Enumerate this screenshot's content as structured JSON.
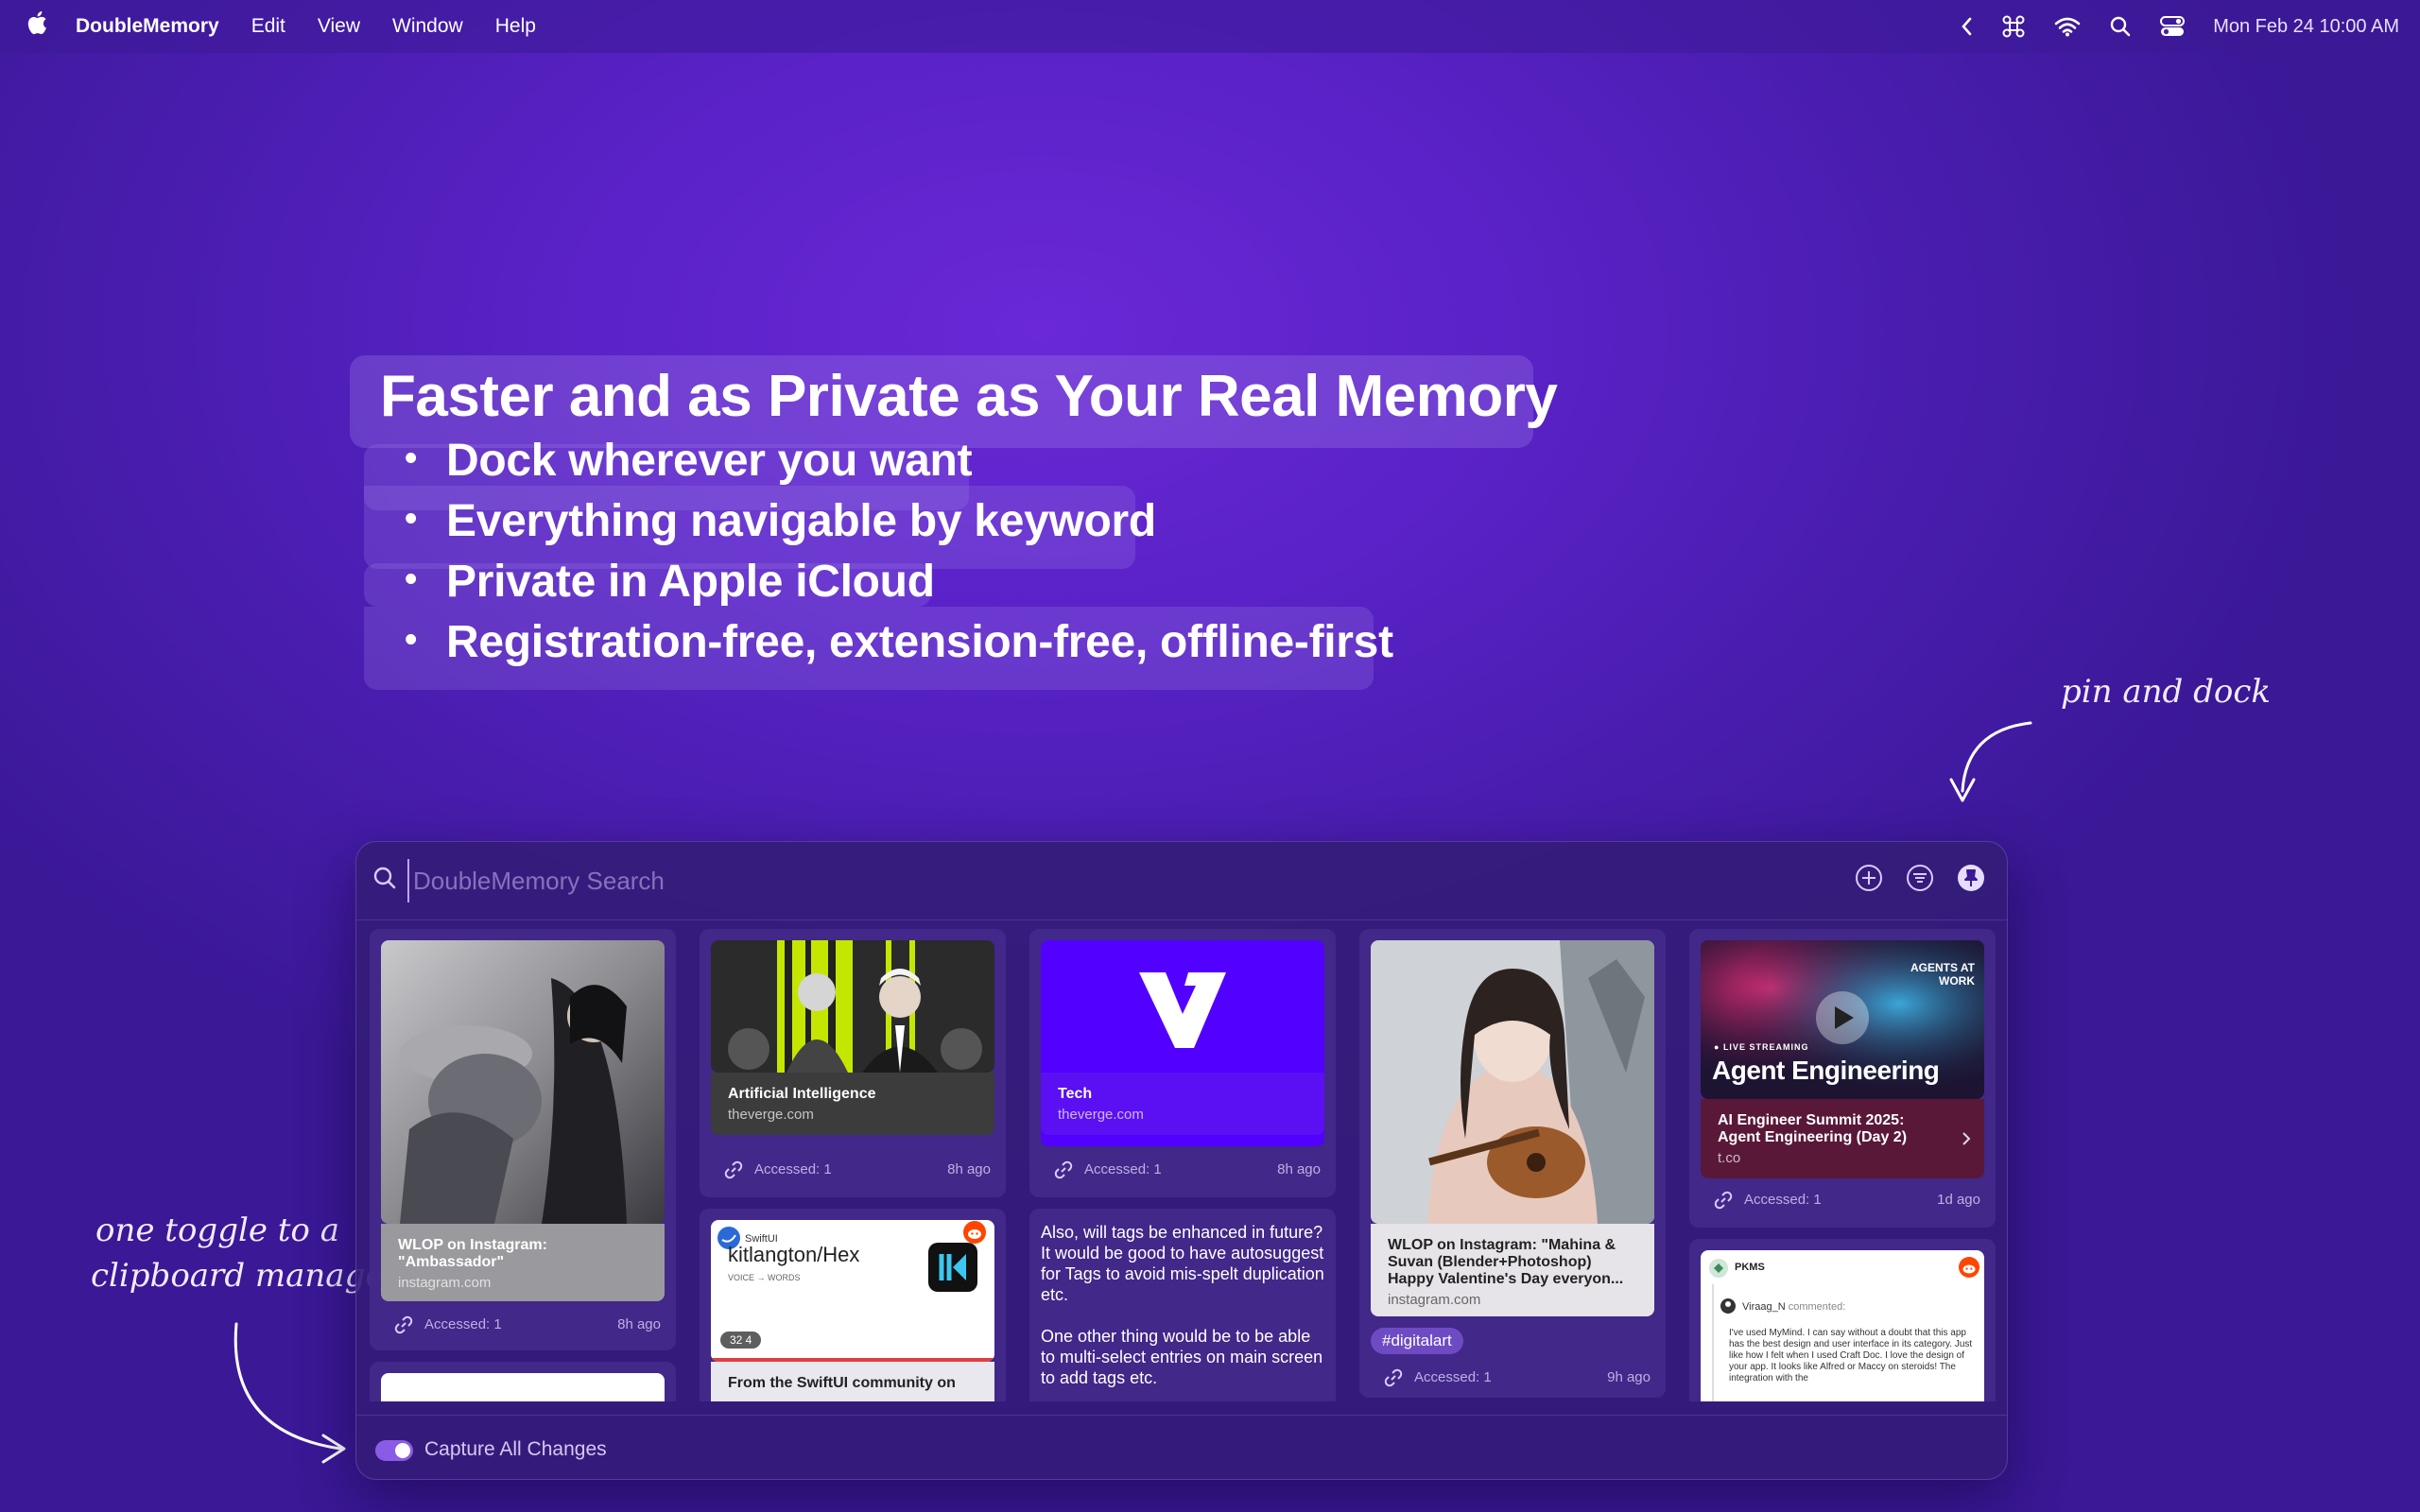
{
  "menubar": {
    "app_name": "DoubleMemory",
    "items": [
      "Edit",
      "View",
      "Window",
      "Help"
    ],
    "clock": "Mon Feb 24  10:00 AM"
  },
  "hero": {
    "title": "Faster and as Private as Your Real Memory",
    "bullets": [
      "Dock wherever you want",
      "Everything navigable by keyword",
      "Private in Apple iCloud",
      "Registration-free, extension-free, offline-first"
    ]
  },
  "annotations": {
    "pin_dock": "pin and dock",
    "toggle_line1": "one toggle to a",
    "toggle_line2": "clipboard manager"
  },
  "search": {
    "placeholder": "DoubleMemory Search"
  },
  "cards": {
    "c1": {
      "title": "WLOP on Instagram: \"Ambassador\"",
      "source": "instagram.com",
      "accessed": "Accessed: 1",
      "age": "8h ago"
    },
    "c2": {
      "title": "Artificial Intelligence",
      "source": "theverge.com",
      "accessed": "Accessed: 1",
      "age": "8h ago"
    },
    "c3": {
      "title": "Tech",
      "source": "theverge.com",
      "accessed": "Accessed: 1",
      "age": "8h ago"
    },
    "c4": {
      "title": "WLOP on Instagram: \"Mahina & Suvan (Blender+Photoshop) Happy Valentine's Day everyon...",
      "source": "instagram.com",
      "tag": "#digitalart",
      "accessed": "Accessed: 1",
      "age": "9h ago"
    },
    "c5": {
      "badge": "LIVE STREAMING",
      "banner": "Agent Engineering",
      "corner": "AGENTS AT WORK",
      "title": "AI Engineer Summit 2025: Agent Engineering (Day 2)",
      "source": "t.co",
      "accessed": "Accessed: 1",
      "age": "1d ago"
    },
    "c6": {
      "org": "SwiftUI",
      "repo": "kitlangton/Hex",
      "desc": "VOICE → WORDS",
      "stats": "32   4",
      "title": "From the SwiftUI community on"
    },
    "c7": {
      "text": "Also, will tags be enhanced in future?  It would be good to have autosuggest for Tags to avoid mis-spelt duplication etc.\n\nOne other thing would be to be able to multi-select entries on main screen to add tags etc."
    },
    "c8": {
      "community": "PKMS",
      "user": "Viraag_N",
      "action": "commented:",
      "body": "I've used MyMind. I can say without a doubt that this app has the best design and user interface in its category. Just like how I felt when I used Craft Doc. I love the design of your app. It looks like Alfred or Maccy on steroids! The integration with the"
    }
  },
  "bottom": {
    "toggle_label": "Capture All Changes",
    "toggle_on": true
  },
  "colors": {
    "accent": "#8a5ce6",
    "background": "#5a22c8",
    "verge": "#5200ff"
  }
}
